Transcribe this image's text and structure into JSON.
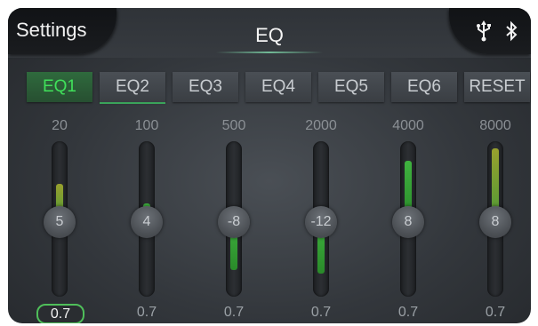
{
  "header": {
    "settings_label": "Settings",
    "title": "EQ",
    "status_icons": [
      "usb-icon",
      "bluetooth-icon"
    ]
  },
  "tabs": [
    {
      "label": "EQ1",
      "active": true
    },
    {
      "label": "EQ2",
      "active": false
    },
    {
      "label": "EQ3",
      "active": false
    },
    {
      "label": "EQ4",
      "active": false
    },
    {
      "label": "EQ5",
      "active": false
    },
    {
      "label": "EQ6",
      "active": false
    },
    {
      "label": "RESET",
      "active": false
    }
  ],
  "bands": [
    {
      "freq": "20",
      "gain": "5",
      "q": "0.7"
    },
    {
      "freq": "100",
      "gain": "4",
      "q": "0.7"
    },
    {
      "freq": "500",
      "gain": "-8",
      "q": "0.7"
    },
    {
      "freq": "2000",
      "gain": "-12",
      "q": "0.7"
    },
    {
      "freq": "4000",
      "gain": "8",
      "q": "0.7"
    },
    {
      "freq": "8000",
      "gain": "8",
      "q": "0.7"
    }
  ],
  "colors": {
    "active_tab_text": "#40e05a",
    "slider_fill_green": "#3fb23f",
    "slider_fill_olive": "#98a02e",
    "q_active_outline": "#4fbf5a"
  }
}
